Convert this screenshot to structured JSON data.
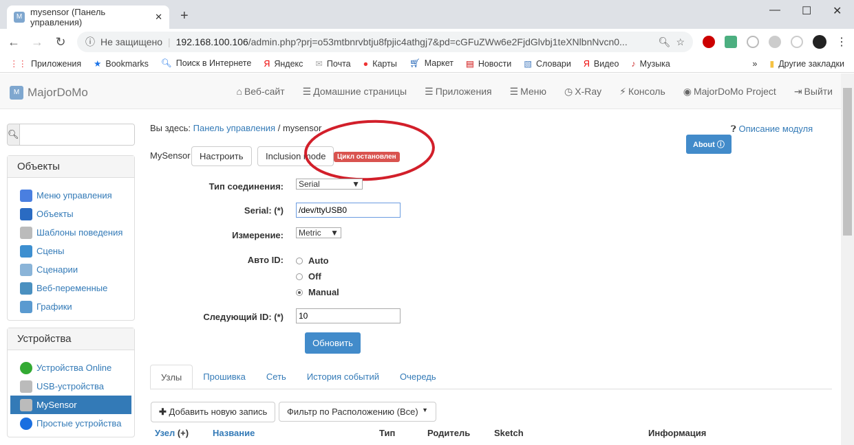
{
  "browser": {
    "tab_title": "mysensor (Панель управления)",
    "security": "Не защищено",
    "url_host": "192.168.100.106",
    "url_path": "/admin.php?prj=o53mtbnrvbtju8fpjic4athgj7&pd=cGFuZWw6e2FjdGlvbj1teXNlbnNvcn0...",
    "bookmarks": [
      {
        "label": "Приложения",
        "icon": "apps-grid-icon"
      },
      {
        "label": "Bookmarks",
        "icon": "star-icon"
      },
      {
        "label": "Поиск в Интернете",
        "icon": "search-icon"
      },
      {
        "label": "Яндекс",
        "icon": "yandex-icon"
      },
      {
        "label": "Почта",
        "icon": "mail-icon"
      },
      {
        "label": "Карты",
        "icon": "map-pin-icon"
      },
      {
        "label": "Маркет",
        "icon": "cart-icon"
      },
      {
        "label": "Новости",
        "icon": "news-icon"
      },
      {
        "label": "Словари",
        "icon": "dictionary-icon"
      },
      {
        "label": "Видео",
        "icon": "yandex-icon"
      },
      {
        "label": "Музыка",
        "icon": "music-icon"
      }
    ],
    "more": "»",
    "other_bookmarks": "Другие закладки"
  },
  "app": {
    "brand": "MajorDoMo",
    "menu": [
      {
        "label": "Веб-сайт",
        "icon": "home-icon"
      },
      {
        "label": "Домашние страницы",
        "icon": "list-icon"
      },
      {
        "label": "Приложения",
        "icon": "list-icon"
      },
      {
        "label": "Меню",
        "icon": "list-icon"
      },
      {
        "label": "X-Ray",
        "icon": "clock-icon"
      },
      {
        "label": "Консоль",
        "icon": "bolt-icon"
      },
      {
        "label": "MajorDoMo Project",
        "icon": "globe-icon"
      },
      {
        "label": "Выйти",
        "icon": "logout-icon"
      }
    ]
  },
  "sidebar": {
    "search_placeholder": "",
    "objects": {
      "title": "Объекты",
      "items": [
        "Меню управления",
        "Объекты",
        "Шаблоны поведения",
        "Сцены",
        "Сценарии",
        "Веб-переменные",
        "Графики"
      ]
    },
    "devices": {
      "title": "Устройства",
      "items": [
        "Устройства Online",
        "USB-устройства",
        "MySensor",
        "Простые устройства"
      ]
    }
  },
  "main": {
    "breadcrumb_prefix": "Вы здесь:",
    "breadcrumb_link": "Панель управления",
    "breadcrumb_sep": "/",
    "breadcrumb_current": "mysensor",
    "help_link": "Описание модуля",
    "about": "About",
    "module": "MySensor",
    "configure": "Настроить",
    "inclusion": "Inclusion mode",
    "status_badge": "Цикл остановлен",
    "badge_color": "#d9534f",
    "form": {
      "conn_label": "Тип соединения:",
      "conn_value": "Serial",
      "serial_label": "Serial: (*)",
      "serial_value": "/dev/ttyUSB0",
      "measure_label": "Измерение:",
      "measure_value": "Metric",
      "autoid_label": "Авто ID:",
      "autoid_options": [
        "Auto",
        "Off",
        "Manual"
      ],
      "autoid_selected": "Manual",
      "nextid_label": "Следующий ID: (*)",
      "nextid_value": "10",
      "update": "Обновить"
    },
    "tabs": [
      "Узлы",
      "Прошивка",
      "Сеть",
      "История событий",
      "Очередь"
    ],
    "add": "Добавить новую запись",
    "filter": "Фильтр по Расположению (Все)",
    "columns": [
      "Узел",
      "(+)",
      "Название",
      "Тип",
      "Родитель",
      "Sketch",
      "Информация"
    ]
  }
}
